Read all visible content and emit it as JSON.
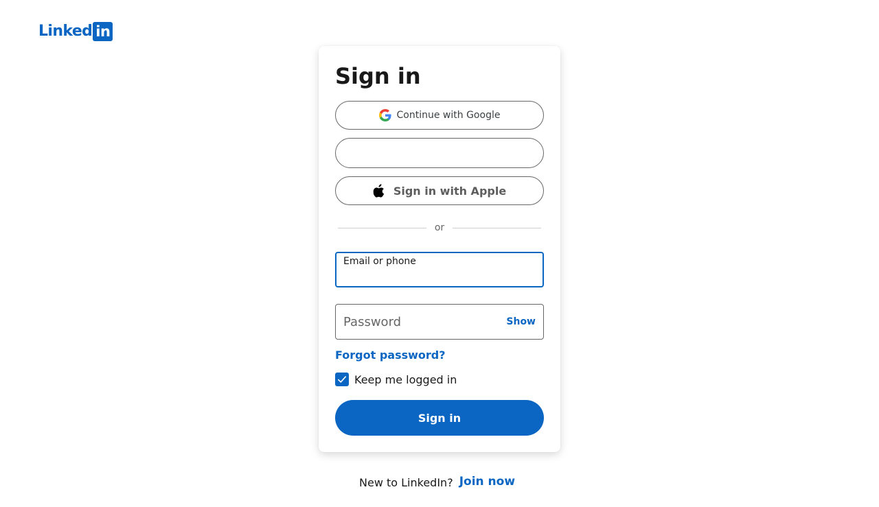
{
  "brand": {
    "logo_word": "Linked",
    "logo_box": "in",
    "color": "#0a66c2"
  },
  "signin": {
    "title": "Sign in",
    "google_label": "Continue with Google",
    "google_icon": "google-g-icon",
    "apple_label": "Sign in with Apple",
    "apple_icon": "apple-icon",
    "divider_text": "or",
    "email_label": "Email or phone",
    "email_value": "",
    "password_placeholder": "Password",
    "password_value": "",
    "show_label": "Show",
    "forgot_label": "Forgot password?",
    "keep_logged_in_label": "Keep me logged in",
    "keep_logged_in_checked": true,
    "submit_label": "Sign in"
  },
  "footer": {
    "question": "New to LinkedIn?",
    "join_label": "Join now"
  }
}
